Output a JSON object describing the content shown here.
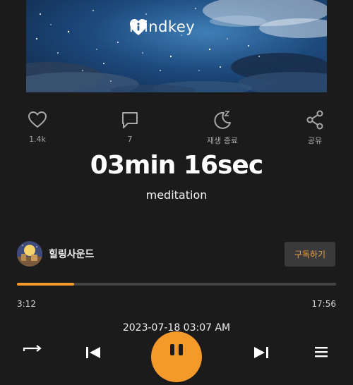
{
  "hero": {
    "brand_name": "mindkey",
    "logo_icon": "mindkey-heart-logo"
  },
  "actions": [
    {
      "icon": "heart-icon",
      "label": "1.4k"
    },
    {
      "icon": "comment-icon",
      "label": "7"
    },
    {
      "icon": "sleep-timer-icon",
      "label": "재생 종료"
    },
    {
      "icon": "share-icon",
      "label": "공유"
    }
  ],
  "track": {
    "duration_text": "03min 16sec",
    "category": "meditation"
  },
  "channel": {
    "name": "힐링사운드",
    "subscribe_label": "구독하기"
  },
  "progress": {
    "fraction": 0.18,
    "elapsed": "3:12",
    "total": "17:56"
  },
  "uploaded_at": "2023-07-18 03:07 AM",
  "colors": {
    "accent": "#f39a2b",
    "background": "#1b1b1b",
    "muted": "#a8a8a8"
  },
  "controls": [
    "repeat-icon",
    "previous-icon",
    "pause-icon",
    "next-icon",
    "playlist-icon"
  ]
}
